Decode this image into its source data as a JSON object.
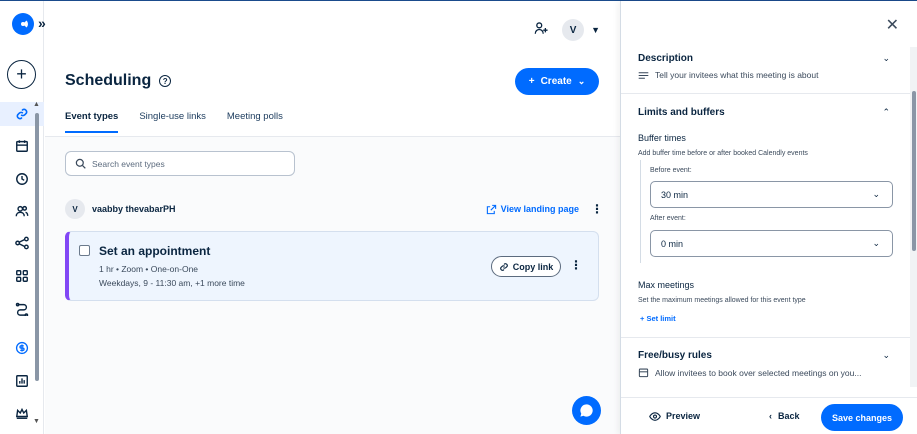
{
  "rail": {
    "expand_glyph": "»",
    "plus_glyph": "+",
    "items": [
      {
        "name": "link-icon",
        "active": true
      },
      {
        "name": "calendar-icon"
      },
      {
        "name": "clock-icon"
      },
      {
        "name": "people-icon"
      },
      {
        "name": "workflow-icon"
      },
      {
        "name": "apps-icon"
      },
      {
        "name": "routing-icon"
      },
      {
        "name": "dollar-icon"
      },
      {
        "name": "analytics-icon"
      },
      {
        "name": "admin-crown-icon"
      }
    ]
  },
  "header": {
    "avatar_initial": "V",
    "title": "Scheduling",
    "create_label": "Create"
  },
  "tabs": [
    {
      "label": "Event types",
      "active": true
    },
    {
      "label": "Single-use links"
    },
    {
      "label": "Meeting polls"
    }
  ],
  "search": {
    "placeholder": "Search event types"
  },
  "user": {
    "initial": "V",
    "name": "vaabby thevabarPH",
    "landing_label": "View landing page"
  },
  "event": {
    "title": "Set an appointment",
    "meta": "1 hr • Zoom • One-on-One",
    "schedule": "Weekdays, 9 - 11:30 am, +1 more time",
    "copy_label": "Copy link",
    "accent_color": "#8247f5"
  },
  "panel": {
    "description": {
      "title": "Description",
      "hint": "Tell your invitees what this meeting is about"
    },
    "limits": {
      "title": "Limits and buffers",
      "buffer_title": "Buffer times",
      "buffer_hint": "Add buffer time before or after booked Calendly events",
      "before_label": "Before event:",
      "before_value": "30 min",
      "after_label": "After event:",
      "after_value": "0 min",
      "max_title": "Max meetings",
      "max_hint": "Set the maximum meetings allowed for this event type",
      "set_limit_label": "Set limit"
    },
    "freebusy": {
      "title": "Free/busy rules",
      "hint": "Allow invitees to book over selected meetings on you..."
    },
    "footer": {
      "preview_label": "Preview",
      "back_label": "Back",
      "save_label": "Save changes"
    }
  },
  "colors": {
    "primary": "#006bff",
    "text": "#0a2540"
  }
}
